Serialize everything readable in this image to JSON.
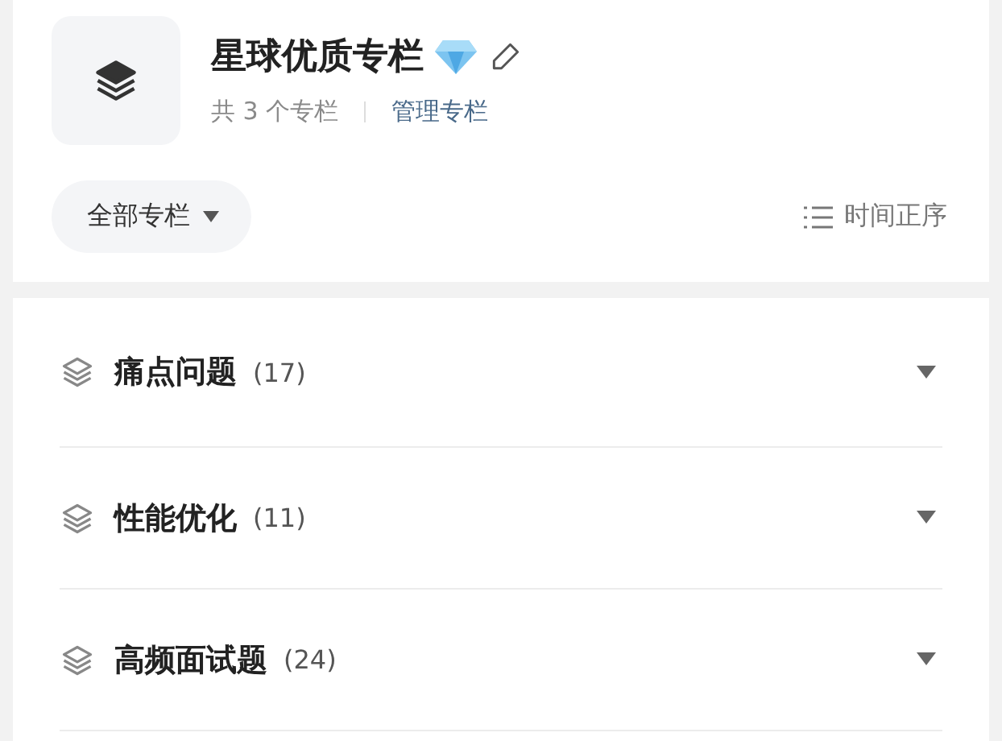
{
  "header": {
    "title": "星球优质专栏",
    "count_text": "共 3 个专栏",
    "manage_link": "管理专栏"
  },
  "filter": {
    "label": "全部专栏"
  },
  "sort": {
    "label": "时间正序"
  },
  "columns": [
    {
      "name": "痛点问题",
      "count": "(17)"
    },
    {
      "name": "性能优化",
      "count": "(11)"
    },
    {
      "name": "高频面试题",
      "count": "(24)"
    }
  ]
}
